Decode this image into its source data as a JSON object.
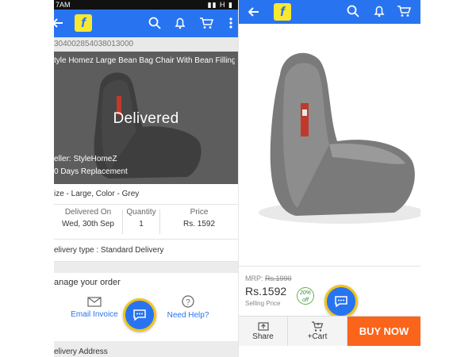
{
  "left_screen": {
    "status_time": "7AM",
    "status_icons": "▮▮ H ▮",
    "order_id": "304002854038013000",
    "product_title": "tyle Homez Large Bean Bag Chair With Bean Filling",
    "hero_status": "Delivered",
    "seller": "eller: StyleHomeZ",
    "replacement": "0 Days Replacement",
    "variant": "ize - Large, Color - Grey",
    "table": {
      "delivered_label": "Delivered On",
      "delivered_value": "Wed, 30th Sep",
      "quantity_label": "Quantity",
      "quantity_value": "1",
      "price_label": "Price",
      "price_value": "Rs. 1592"
    },
    "delivery_type": "elivery type : Standard Delivery",
    "manage_heading": "anage your order",
    "email_invoice": "Email Invoice",
    "need_help": "Need Help?",
    "footer_cut": "elivery Address"
  },
  "right_screen": {
    "mrp_label": "MRP:",
    "mrp_value": "Rs.1990",
    "price": "Rs.1592",
    "selling_label": "Selling Price",
    "discount": "20%",
    "discount_off": "off",
    "share_label": "Share",
    "cart_label": "+Cart",
    "buy_now": "BUY NOW"
  },
  "icons": {
    "back": "back-arrow-icon",
    "logo": "flipkart-logo-icon",
    "search": "search-icon",
    "bell": "bell-icon",
    "cart": "cart-icon",
    "more": "more-vertical-icon",
    "chat": "chat-icon",
    "mail": "mail-icon",
    "help": "help-icon",
    "share": "share-icon",
    "add_cart": "add-to-cart-icon"
  },
  "colors": {
    "primary": "#2874f0",
    "logo_yellow": "#f8e831",
    "buy_orange": "#fb641b",
    "fab_ring": "#f0c419",
    "discount_green": "#388e3c"
  }
}
